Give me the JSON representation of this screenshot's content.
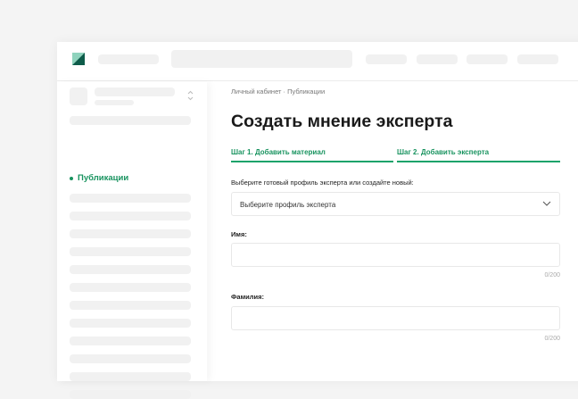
{
  "sidebar": {
    "active_item": "Публикации"
  },
  "breadcrumb": "Личный кабинет · Публикации",
  "title": "Создать мнение эксперта",
  "tabs": [
    "Шаг 1. Добавить материал",
    "Шаг 2. Добавить эксперта"
  ],
  "colors": {
    "accent": "#1aa36a",
    "logo_dark": "#0e5c4a",
    "logo_light": "#8fd3bd"
  },
  "form": {
    "profile_label": "Выберите готовый профиль эксперта или создайте новый:",
    "profile_select": "Выберите профиль эксперта",
    "name_label": "Имя:",
    "name_counter": "0/200",
    "surname_label": "Фамилия:",
    "surname_counter": "0/200"
  }
}
